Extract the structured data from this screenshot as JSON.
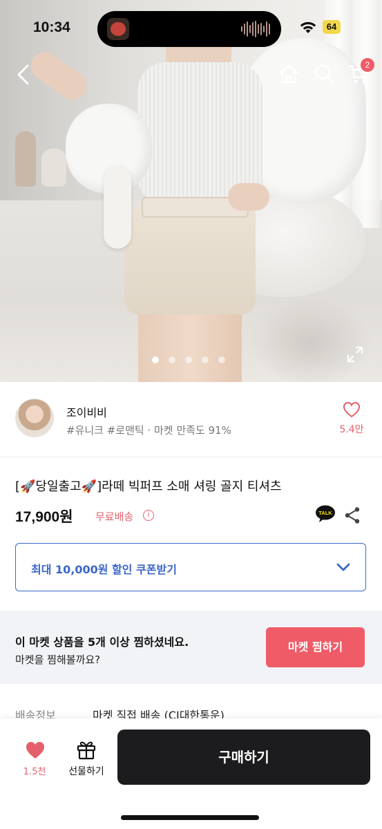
{
  "status_bar": {
    "time": "10:34",
    "battery": "64",
    "battery_color": "#f2d64b"
  },
  "nav": {
    "icons": [
      "back-arrow-icon",
      "home-icon",
      "search-icon",
      "cart-icon"
    ],
    "cart_badge": "2"
  },
  "carousel": {
    "total_dots": 5,
    "active_index": 0,
    "icons": [
      "expand-icon"
    ]
  },
  "seller": {
    "name": "조이비비",
    "tags": "#유니크 #로맨틱 · 마켓 만족도 91%",
    "favorite_count": "5.4만",
    "icons": [
      "heart-outline-icon"
    ]
  },
  "product": {
    "title": "[🚀당일출고🚀]라떼 빅퍼프 소매 셔링 골지 티셔츠",
    "price": "17,900원",
    "shipping": "무료배송",
    "icons": [
      "info-icon",
      "kakao-talk-icon",
      "share-icon"
    ]
  },
  "coupon": {
    "label": "최대 10,000원 할인 쿠폰받기",
    "accent_color": "#3b66c9",
    "icons": [
      "chevron-down-icon"
    ]
  },
  "promo": {
    "line1": "이 마켓 상품을 5개 이상 찜하셨네요.",
    "line2": "마켓을 찜해볼까요?",
    "button": "마켓 찜하기",
    "button_color": "#ef5c67"
  },
  "shipping_info": {
    "label": "배송정보",
    "value": "마켓 직접 배송 (CJ대한통운)"
  },
  "bottom_bar": {
    "like_count": "1.5천",
    "gift_label": "선물하기",
    "buy_label": "구매하기",
    "icons": [
      "heart-filled-icon",
      "gift-icon"
    ]
  },
  "colors": {
    "accent_red": "#e4606b",
    "dark_button": "#1c1c1e"
  }
}
